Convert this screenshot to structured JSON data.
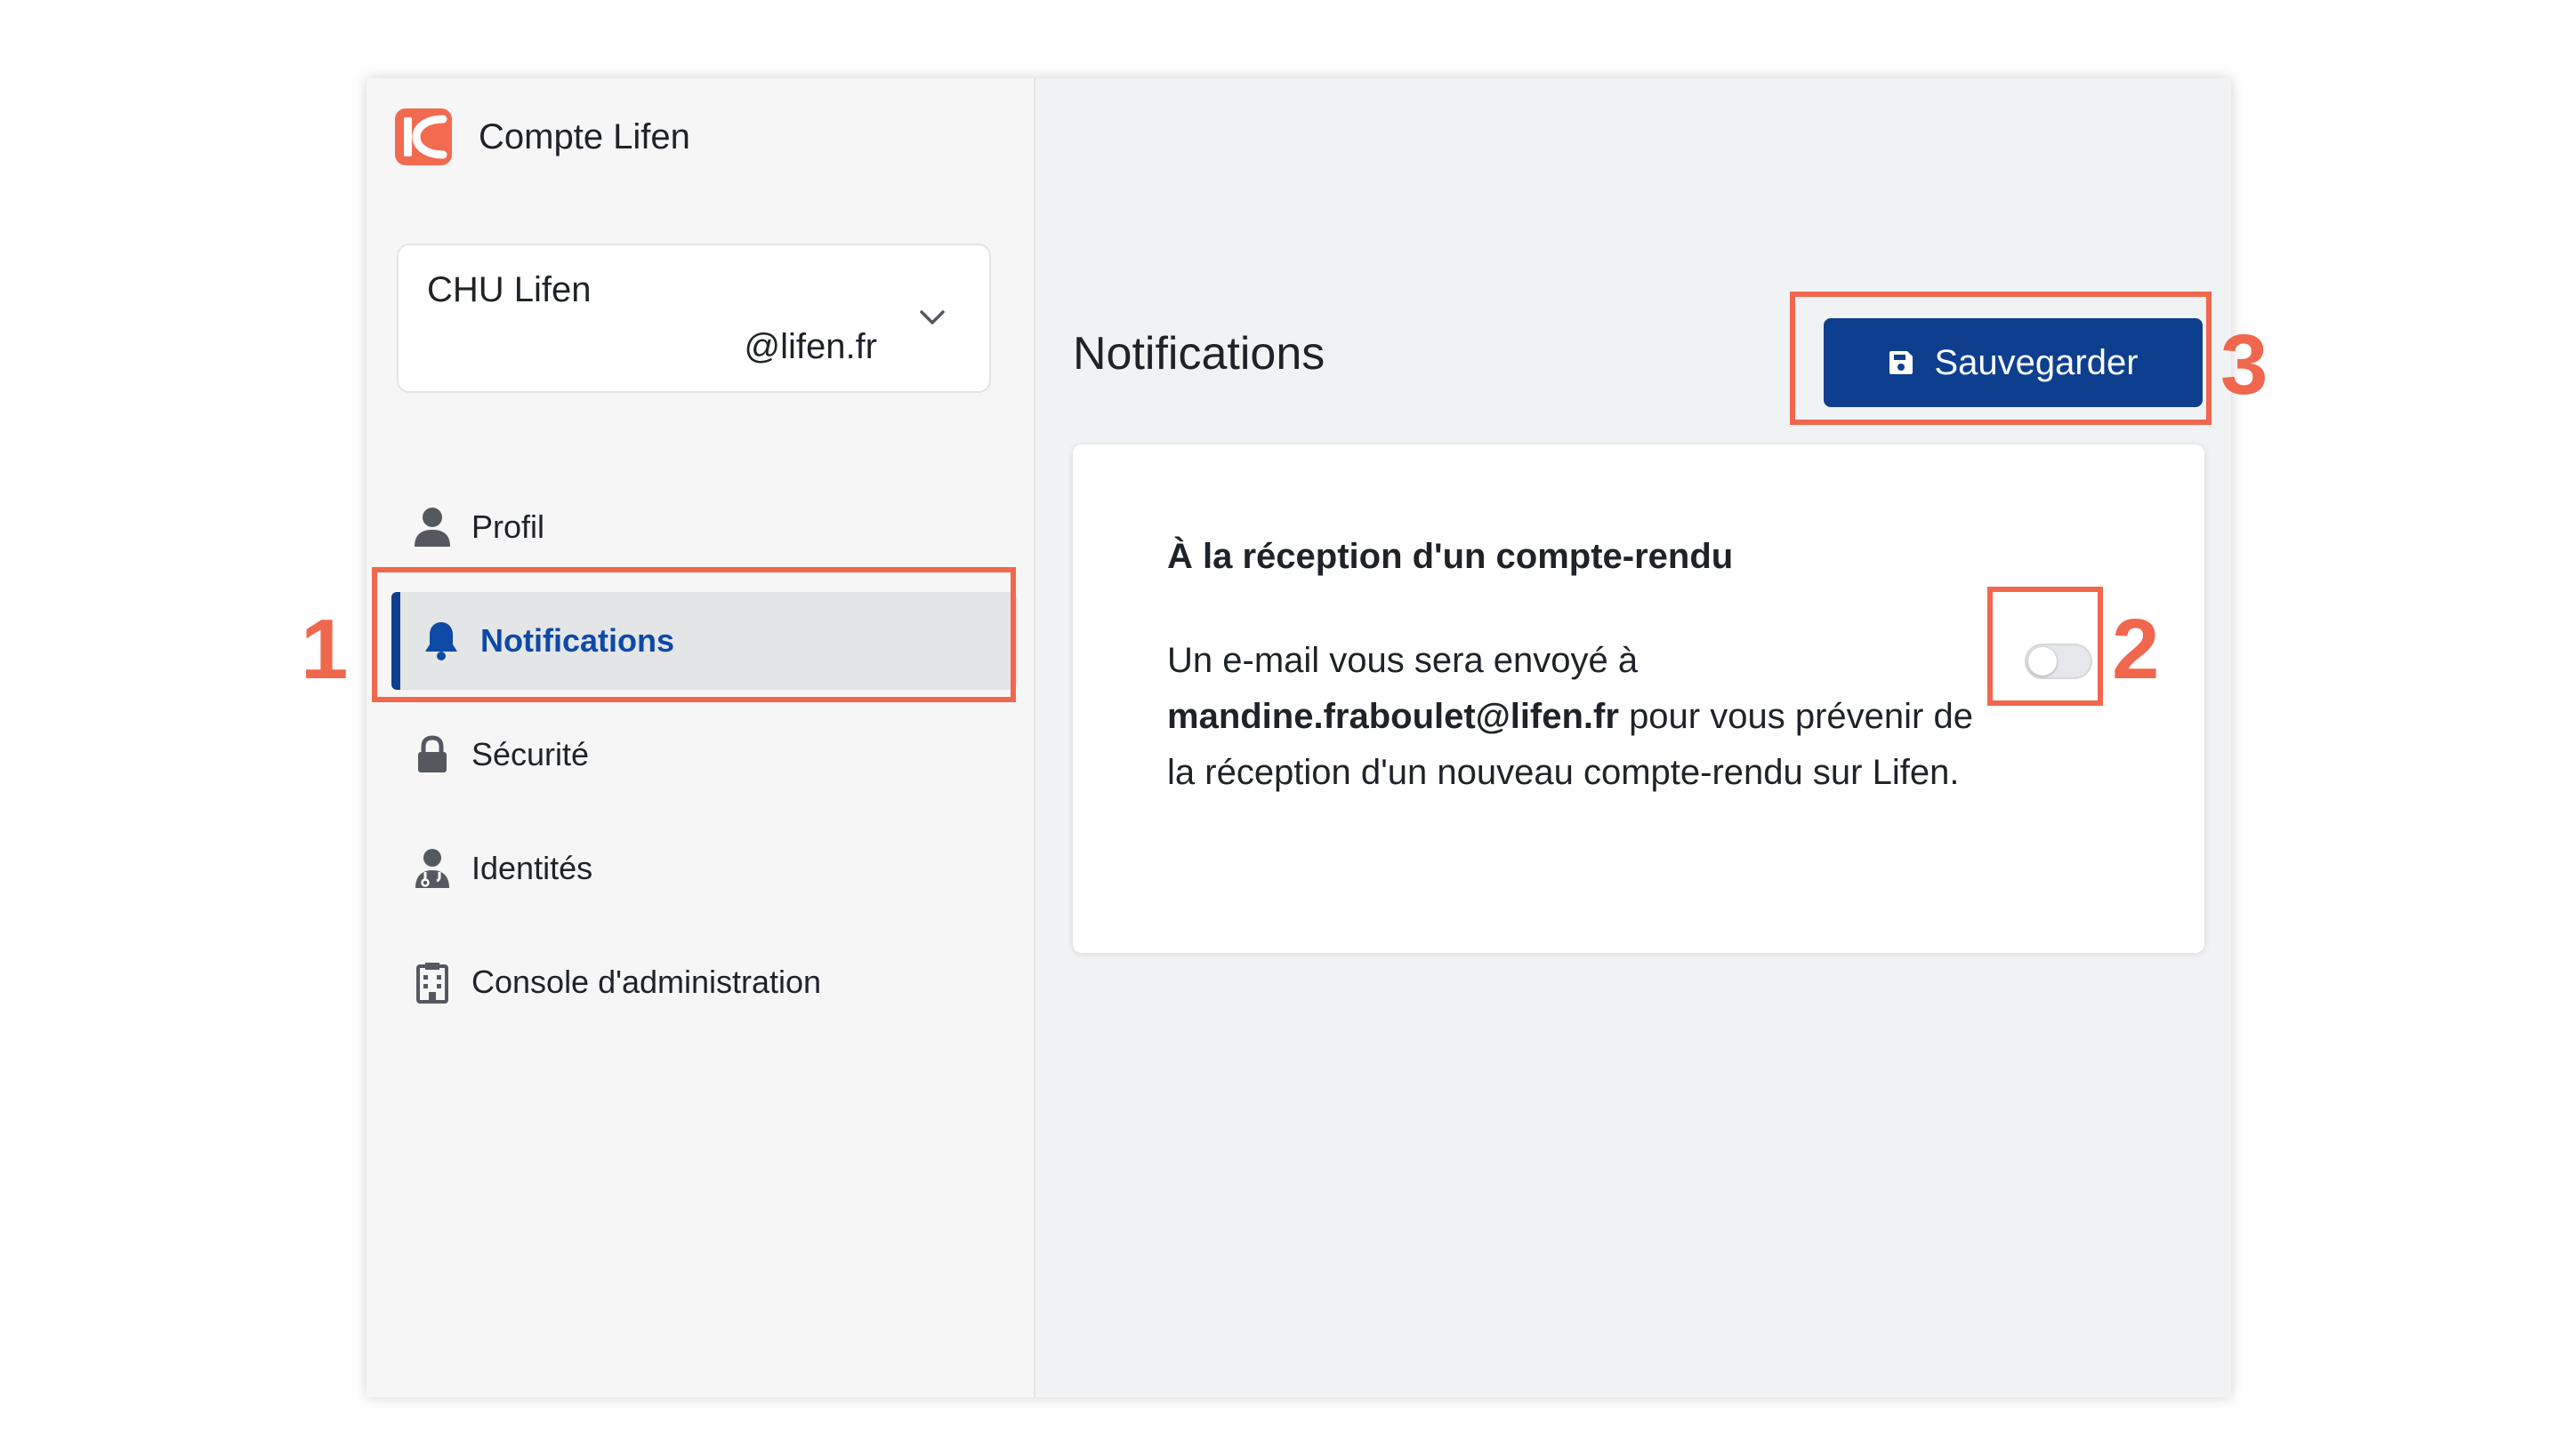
{
  "app": {
    "title": "Compte Lifen"
  },
  "account": {
    "name": "CHU Lifen",
    "email": "@lifen.fr"
  },
  "nav": {
    "items": [
      {
        "label": "Profil",
        "icon": "user-icon"
      },
      {
        "label": "Notifications",
        "icon": "bell-icon",
        "active": true
      },
      {
        "label": "Sécurité",
        "icon": "lock-icon"
      },
      {
        "label": "Identités",
        "icon": "doctor-icon"
      },
      {
        "label": "Console d'administration",
        "icon": "building-icon"
      }
    ]
  },
  "page": {
    "title": "Notifications"
  },
  "toolbar": {
    "save_label": "Sauvegarder",
    "save_icon": "floppy-disk-icon"
  },
  "card": {
    "title": "À la réception d'un compte-rendu",
    "body_prefix": "Un e-mail vous sera envoyé à",
    "email": "mandine.fraboulet@lifen.fr",
    "body_suffix": "pour vous prévenir de la réception d'un nouveau compte-rendu sur Lifen.",
    "toggle_on": false
  },
  "annotations": {
    "n1": "1",
    "n2": "2",
    "n3": "3"
  },
  "colors": {
    "brand": "#f26a4f",
    "primary": "#0e3f8f",
    "active_text": "#0d4aa6",
    "annotation": "#f0674d"
  }
}
